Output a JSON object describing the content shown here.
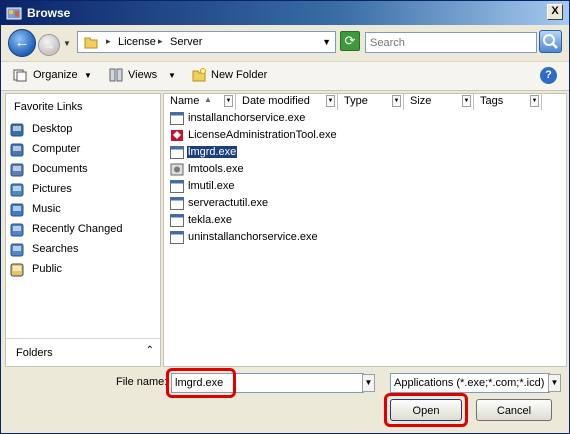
{
  "window": {
    "title": "Browse",
    "close_glyph": "X"
  },
  "nav": {
    "back_glyph": "←",
    "forward_glyph": "→",
    "history_glyph": "▼"
  },
  "address": {
    "crumbs": [
      "License",
      "Server"
    ],
    "separator": "▸",
    "dropdown_glyph": "▼"
  },
  "refresh_glyph": "⟳",
  "search": {
    "placeholder": "Search"
  },
  "toolbar": {
    "organize_label": "Organize",
    "views_label": "Views",
    "new_folder_label": "New Folder",
    "dropdown_glyph": "▼",
    "help_glyph": "?"
  },
  "left_pane": {
    "heading": "Favorite Links",
    "items": [
      {
        "label": "Desktop",
        "icon": "desktop-icon",
        "color": "#3a6ea5"
      },
      {
        "label": "Computer",
        "icon": "computer-icon",
        "color": "#4a76b0"
      },
      {
        "label": "Documents",
        "icon": "documents-icon",
        "color": "#5a7fb5"
      },
      {
        "label": "Pictures",
        "icon": "pictures-icon",
        "color": "#4d8ac0"
      },
      {
        "label": "Music",
        "icon": "music-icon",
        "color": "#3f7cc0"
      },
      {
        "label": "Recently Changed",
        "icon": "recent-icon",
        "color": "#4f86c6"
      },
      {
        "label": "Searches",
        "icon": "searches-icon",
        "color": "#4f86c6"
      },
      {
        "label": "Public",
        "icon": "public-folder-icon",
        "color": "#e8c45a"
      }
    ],
    "folders_label": "Folders",
    "folders_chevron": "⌃"
  },
  "columns": [
    {
      "label": "Name"
    },
    {
      "label": "Date modified"
    },
    {
      "label": "Type"
    },
    {
      "label": "Size"
    },
    {
      "label": "Tags"
    }
  ],
  "sort_glyph": "▲",
  "col_drop_glyph": "▼",
  "files": [
    {
      "name": "installanchorservice.exe",
      "icon": "exe-icon"
    },
    {
      "name": "LicenseAdministrationTool.exe",
      "icon": "license-tool-icon"
    },
    {
      "name": "lmgrd.exe",
      "icon": "exe-icon",
      "selected": true
    },
    {
      "name": "lmtools.exe",
      "icon": "lmtools-icon"
    },
    {
      "name": "lmutil.exe",
      "icon": "exe-icon"
    },
    {
      "name": "serveractutil.exe",
      "icon": "exe-icon"
    },
    {
      "name": "tekla.exe",
      "icon": "exe-icon"
    },
    {
      "name": "uninstallanchorservice.exe",
      "icon": "exe-icon"
    }
  ],
  "file_name": {
    "label": "File name:",
    "value": "lmgrd.exe"
  },
  "filter": {
    "value": "Applications (*.exe;*.com;*.icd)"
  },
  "buttons": {
    "open": "Open",
    "cancel": "Cancel"
  },
  "colors": {
    "highlight": "#e10000",
    "selection": "#1c3e7f",
    "accent": "#0a246a"
  }
}
